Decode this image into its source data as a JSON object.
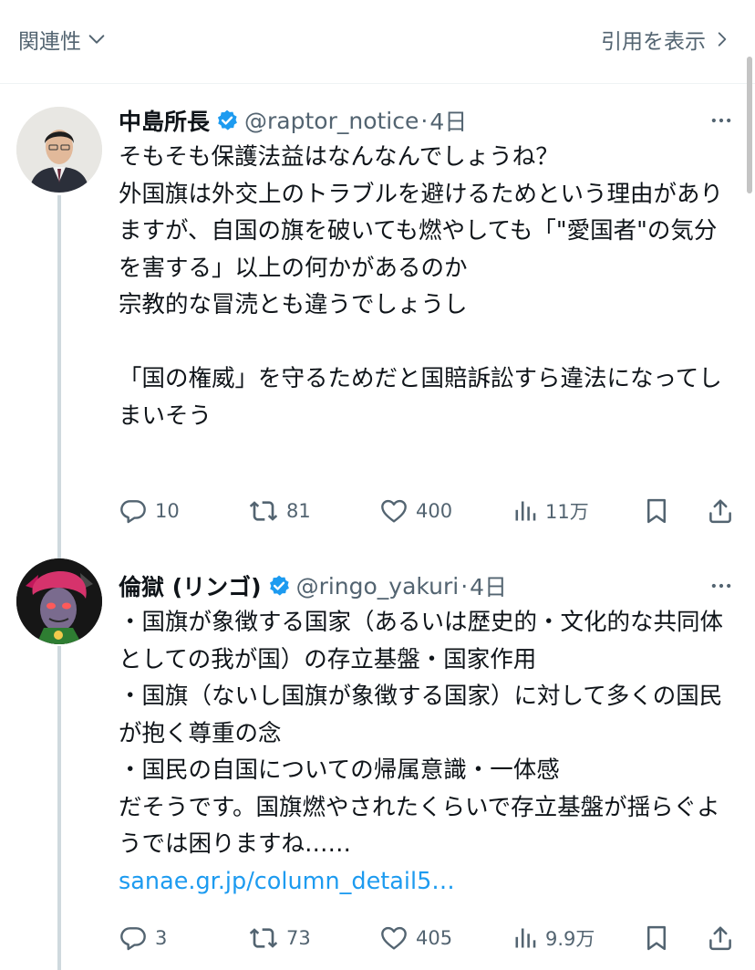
{
  "header": {
    "related_label": "関連性",
    "quote_label": "引用を表示"
  },
  "tweets": [
    {
      "name": "中島所長",
      "handle": "@raptor_notice",
      "time": "4日",
      "body": "そもそも保護法益はなんなんでしょうね？\n外国旗は外交上のトラブルを避けるためという理由がありますが、自国の旗を破いても燃やしても「\"愛国者\"の気分を害する」以上の何かがあるのか\n宗教的な冒涜とも違うでしょうし\n\n「国の権威」を守るためだと国賠訴訟すら違法になってしまいそう",
      "link": "",
      "replies": "10",
      "retweets": "81",
      "likes": "400",
      "views": "11万",
      "verified_color": "#1d9bf0"
    },
    {
      "name": "倫獄 (リンゴ)",
      "handle": "@ringo_yakuri",
      "time": "4日",
      "body": "・国旗が象徴する国家（あるいは歴史的・文化的な共同体としての我が国）の存立基盤・国家作用\n・国旗（ないし国旗が象徴する国家）に対して多くの国民が抱く尊重の念\n・国民の自国についての帰属意識・一体感\nだそうです。国旗燃やされたくらいで存立基盤が揺らぐようでは困りますね……",
      "link": "sanae.gr.jp/column_detail5…",
      "replies": "3",
      "retweets": "73",
      "likes": "405",
      "views": "9.9万",
      "verified_color": "#1d9bf0"
    }
  ],
  "icons": [
    "chevron-down-icon",
    "chevron-right-icon",
    "verified-icon",
    "more-icon",
    "reply-icon",
    "retweet-icon",
    "like-icon",
    "views-icon",
    "bookmark-icon",
    "share-icon"
  ]
}
